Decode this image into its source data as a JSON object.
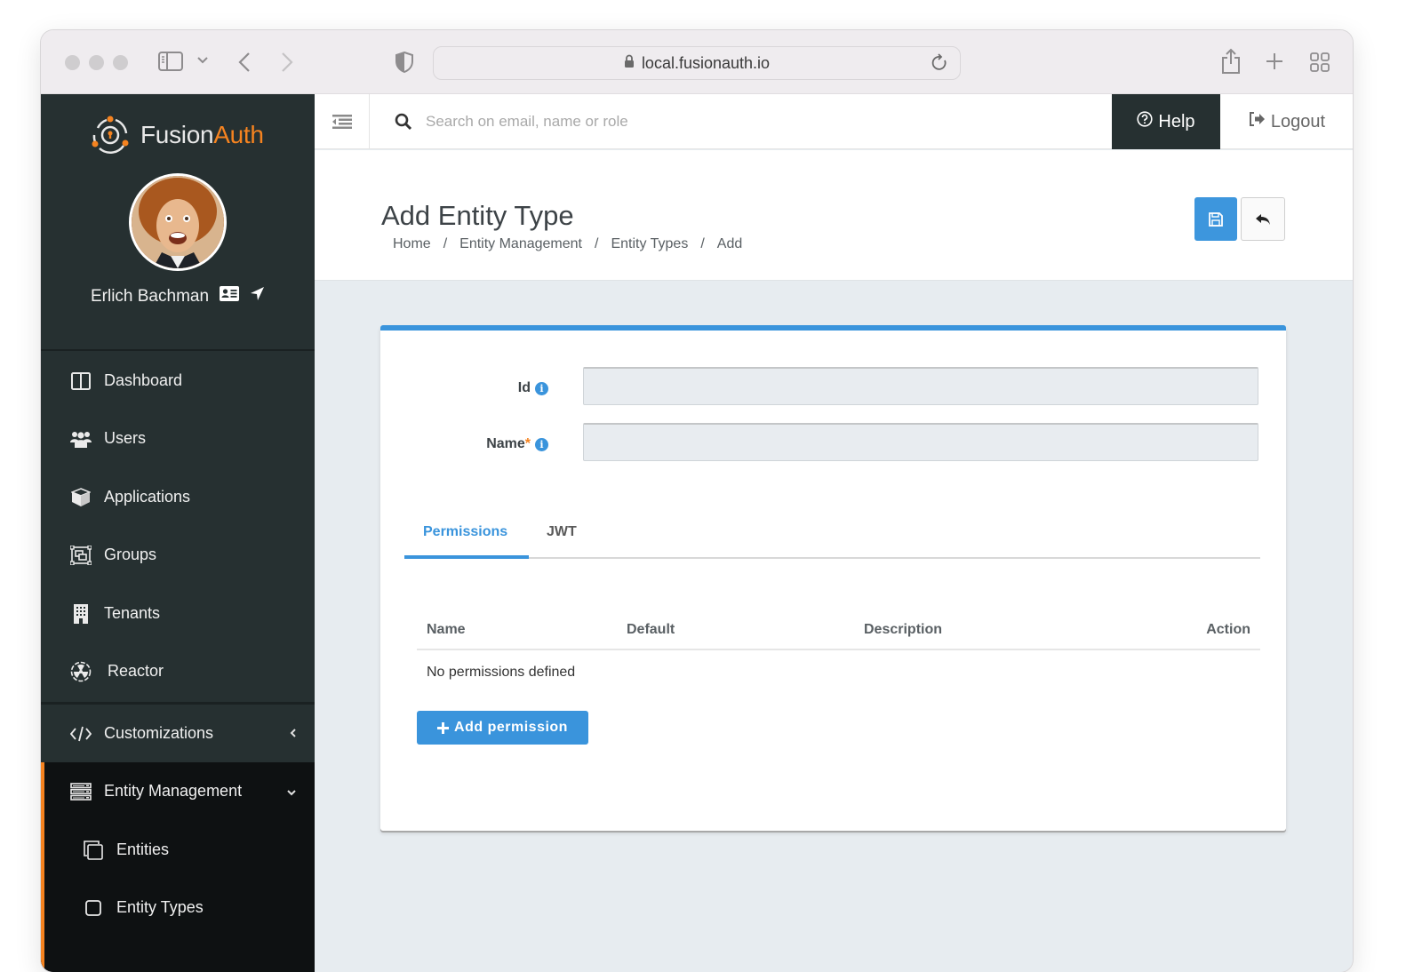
{
  "browser": {
    "url": "local.fusionauth.io",
    "icons": [
      "sidebar-toggle-icon",
      "chevron-down-icon",
      "back-arrow-icon",
      "forward-arrow-icon",
      "privacy-shield-icon",
      "lock-icon",
      "reload-icon",
      "share-icon",
      "new-tab-icon",
      "tab-overview-icon"
    ]
  },
  "brand": {
    "name_part1": "Fusion",
    "name_part2": "Auth",
    "accent": "#f58320"
  },
  "user": {
    "name": "Erlich Bachman"
  },
  "sidebar": {
    "items": [
      {
        "label": "Dashboard",
        "icon": "dashboard-icon"
      },
      {
        "label": "Users",
        "icon": "users-icon"
      },
      {
        "label": "Applications",
        "icon": "cube-icon"
      },
      {
        "label": "Groups",
        "icon": "groups-icon"
      },
      {
        "label": "Tenants",
        "icon": "building-icon"
      },
      {
        "label": "Reactor",
        "icon": "radiation-icon"
      },
      {
        "label": "Customizations",
        "icon": "code-icon",
        "expanded": false
      },
      {
        "label": "Entity Management",
        "icon": "server-icon",
        "expanded": true
      }
    ],
    "subitems": [
      {
        "label": "Entities",
        "icon": "clone-icon"
      },
      {
        "label": "Entity Types",
        "icon": "square-icon",
        "active": true
      }
    ]
  },
  "topbar": {
    "search_placeholder": "Search on email, name or role",
    "help_label": "Help",
    "logout_label": "Logout"
  },
  "page": {
    "title": "Add Entity Type",
    "breadcrumb": [
      "Home",
      "Entity Management",
      "Entity Types",
      "Add"
    ],
    "breadcrumb_sep": "/"
  },
  "form": {
    "id_label": "Id",
    "id_value": "",
    "name_label": "Name",
    "name_required_mark": "*",
    "name_value": ""
  },
  "tabs": [
    {
      "label": "Permissions",
      "active": true
    },
    {
      "label": "JWT",
      "active": false
    }
  ],
  "permissions_table": {
    "columns": [
      "Name",
      "Default",
      "Description",
      "Action"
    ],
    "rows": [],
    "empty_message": "No permissions defined"
  },
  "add_permission_label": "Add permission",
  "colors": {
    "primary": "#3a94dc",
    "sidebar_bg": "#263031",
    "accent": "#f58320"
  }
}
